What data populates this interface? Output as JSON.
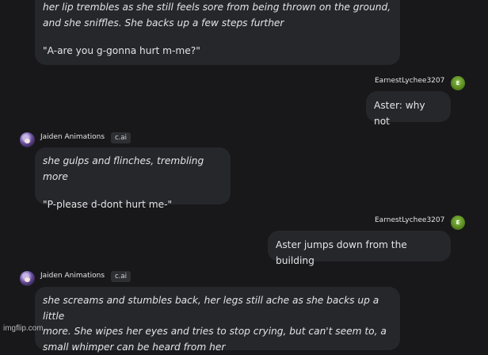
{
  "messages": [
    {
      "role": "bot",
      "lines": [
        "her lip trembles as she still feels sore from being thrown on the ground,",
        "and she sniffles. She backs up a few steps further"
      ],
      "quote": "\"A-are you g-gonna hurt m-me?\""
    },
    {
      "role": "user",
      "author": "EarnestLychee3207",
      "avatar_initial": "E",
      "text": "Aster: why not"
    },
    {
      "role": "bot",
      "author": "Jaiden Animations",
      "badge": "c.ai",
      "lines": [
        "she gulps and flinches, trembling more"
      ],
      "quote": "\"P-please d-dont hurt me-\""
    },
    {
      "role": "user",
      "author": "EarnestLychee3207",
      "avatar_initial": "E",
      "text": "Aster jumps down from the building"
    },
    {
      "role": "bot",
      "author": "Jaiden Animations",
      "badge": "c.ai",
      "lines": [
        "she screams and stumbles back, her legs still ache as she backs up a little",
        "more. She wipes her eyes and tries to stop crying, but can't seem to, a",
        "small whimper can be heard from her"
      ]
    }
  ],
  "watermark": "imgflip.com"
}
